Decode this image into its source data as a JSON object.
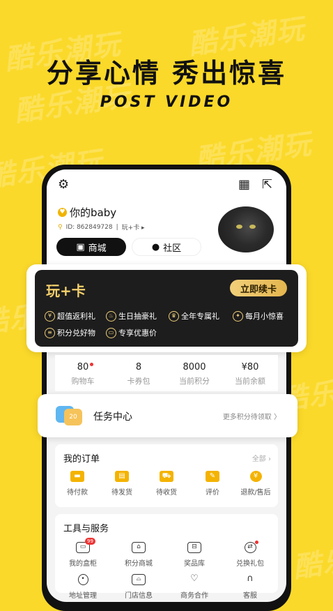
{
  "colors": {
    "background": "#fbd92a",
    "vip_gold": "#f1cf7a",
    "badge_red": "#e33333",
    "order_icon": "#f4b300"
  },
  "watermark": "酷乐潮玩",
  "headline": "分享心情  秀出惊喜",
  "subheadline": "POST VIDEO",
  "profile": {
    "username": "你的baby",
    "id_text": "ID: 862849728",
    "card_link": "玩+卡 ▸",
    "mall_label": "商城",
    "community_label": "社区"
  },
  "vip": {
    "title": "玩+卡",
    "renew_label": "立即续卡",
    "perks": [
      "超值返利礼",
      "生日抽豪礼",
      "全年专属礼",
      "每月小惊喜",
      "积分兑好物",
      "专享优惠价"
    ]
  },
  "stats": [
    {
      "value": "80",
      "label": "购物车"
    },
    {
      "value": "8",
      "label": "卡券包"
    },
    {
      "value": "8000",
      "label": "当前积分"
    },
    {
      "value": "¥80",
      "label": "当前余额"
    }
  ],
  "task": {
    "badge": "20",
    "title": "任务中心",
    "link": "更多积分待领取 〉"
  },
  "orders": {
    "title": "我的订单",
    "more": "全部 ›",
    "items": [
      "待付款",
      "待发货",
      "待收货",
      "评价",
      "退款/售后"
    ]
  },
  "tools": {
    "title": "工具与服务",
    "badge": "99",
    "items": [
      "我的盒柜",
      "积分商城",
      "奖品库",
      "兑换礼包",
      "地址管理",
      "门店信息",
      "商务合作",
      "客服"
    ]
  }
}
